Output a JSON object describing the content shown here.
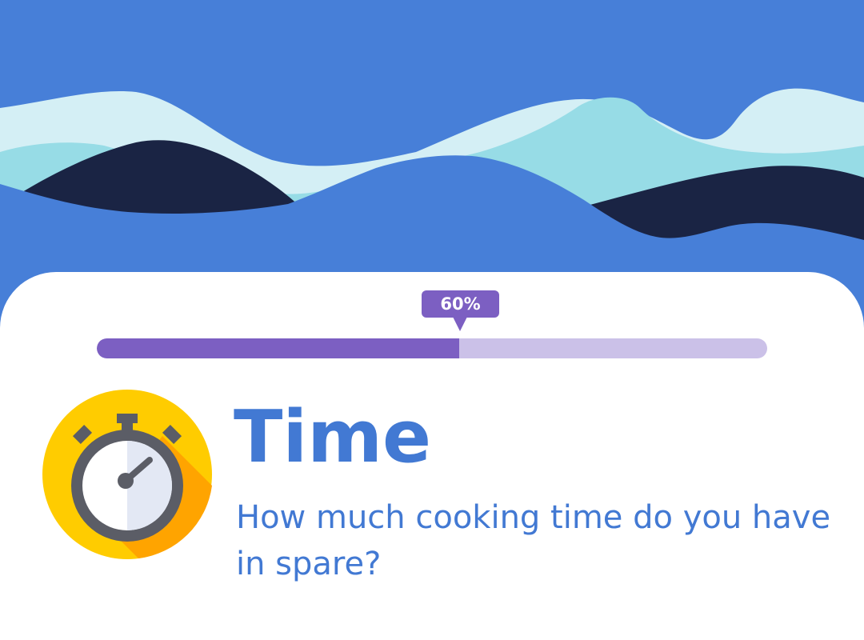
{
  "colors": {
    "sky": "#477fd8",
    "wave_light": "#d4eff5",
    "wave_teal": "#97dce6",
    "wave_navy": "#1a2444",
    "card": "#ffffff",
    "accent_purple": "#7c5fc2",
    "track_purple": "#cbc1e8",
    "text_blue": "#4279d3",
    "icon_yellow": "#ffcc00",
    "icon_orange": "#ffa400"
  },
  "progress": {
    "label": "60%",
    "value": 0.54
  },
  "question": {
    "icon": "stopwatch-icon",
    "title": "Time",
    "text": "How much cooking time do you have in spare?"
  }
}
